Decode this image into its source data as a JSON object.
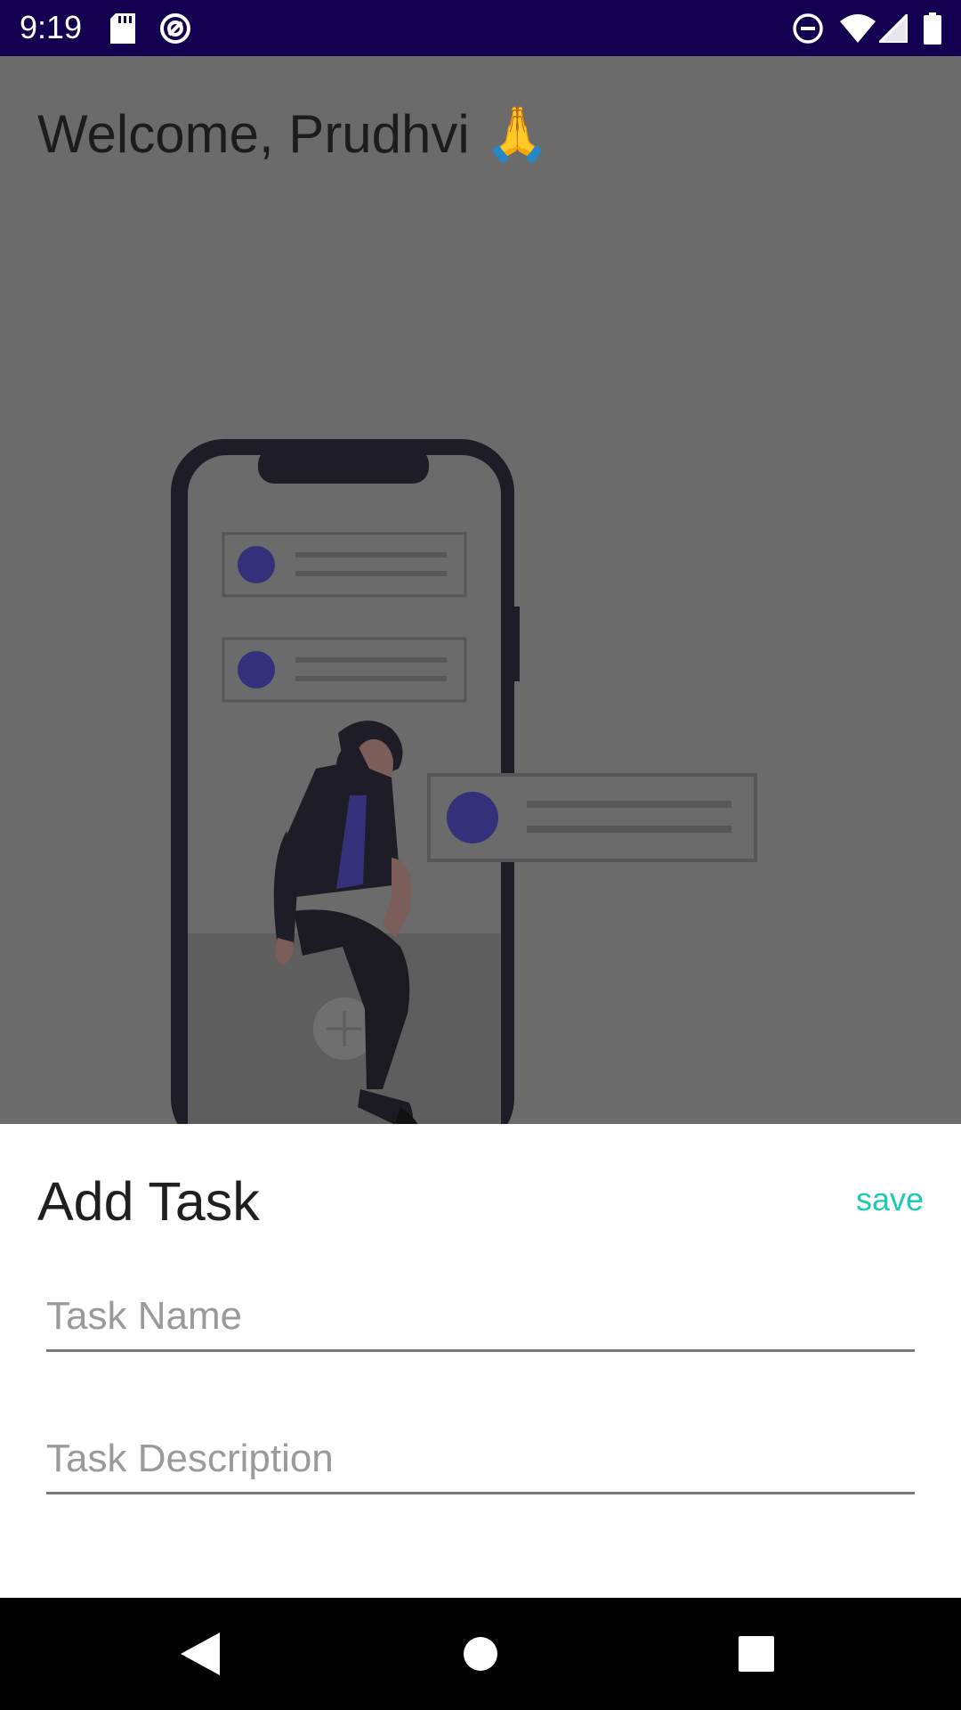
{
  "status_bar": {
    "time": "9:19",
    "icons": [
      "sd-card-icon",
      "sync-icon",
      "do-not-disturb-icon",
      "wifi-icon",
      "cell-signal-icon",
      "battery-icon"
    ]
  },
  "main": {
    "welcome": "Welcome, Prudhvi 🙏",
    "illustration": "phone-with-person-illustration"
  },
  "sheet": {
    "title": "Add Task",
    "save_label": "save",
    "task_name": {
      "value": "",
      "placeholder": "Task Name"
    },
    "task_description": {
      "value": "",
      "placeholder": "Task Description"
    }
  },
  "nav_bar": {
    "icons": [
      "back-icon",
      "home-icon",
      "recents-icon"
    ]
  },
  "colors": {
    "status_bar": "#130051",
    "overlay_dim": "#6b6b6b",
    "accent": "#1ec9b7",
    "illustration_dot": "#34307a"
  }
}
